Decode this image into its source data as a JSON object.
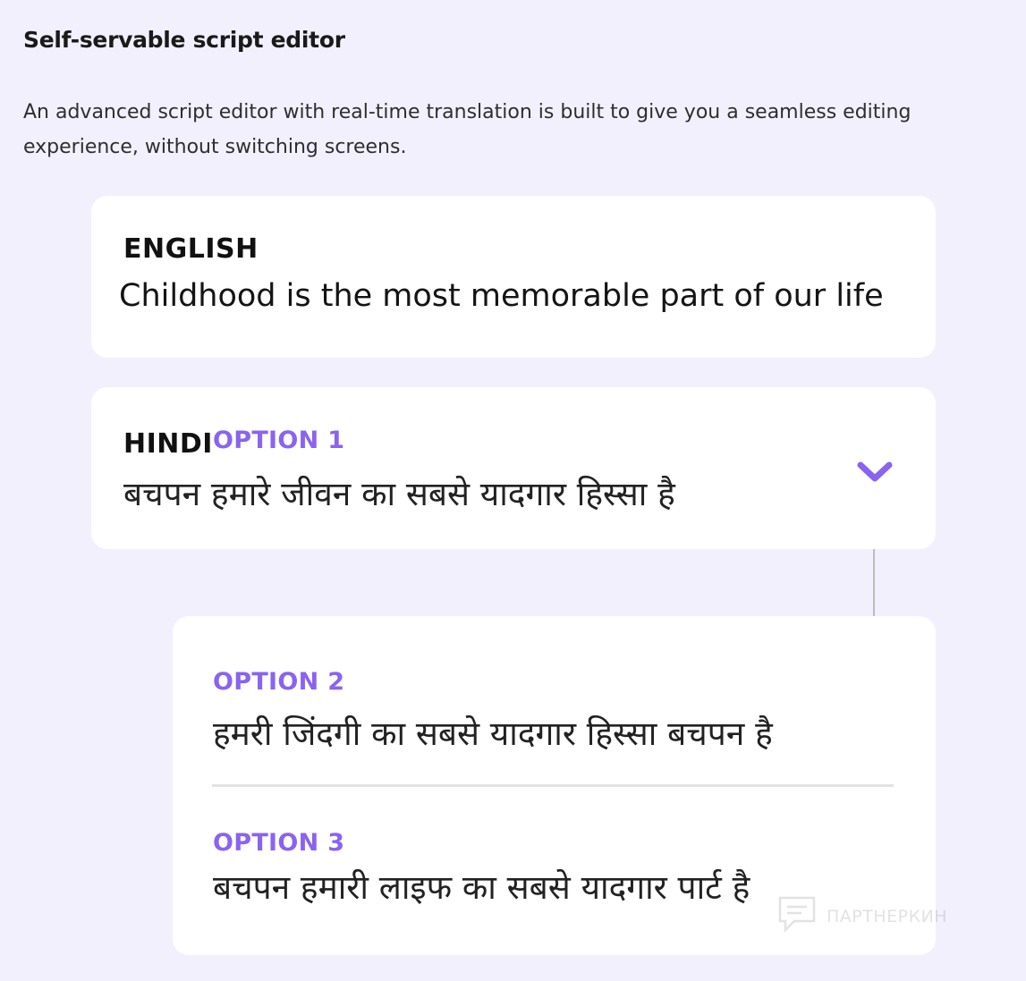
{
  "section": {
    "title": "Self-servable script editor",
    "description": "An advanced script editor with real-time translation is built to give you a seamless editing experience, without switching screens."
  },
  "english_card": {
    "language": "ENGLISH",
    "text": "Childhood is the most memorable part of our life"
  },
  "hindi_card": {
    "language": "HINDI",
    "selected_option": "OPTION 1",
    "text": "बचपन हमारे जीवन का सबसे यादगार हिस्सा है",
    "toggle_icon": "chevron-down-icon"
  },
  "options": [
    {
      "label": "OPTION 2",
      "text": "हमरी जिंदगी का सबसे यादगार हिस्सा बचपन है"
    },
    {
      "label": "OPTION 3",
      "text": "बचपन हमारी लाइफ का सबसे यादगार पार्ट है"
    }
  ],
  "watermark": {
    "text": "ПАРТНЕРКИН",
    "icon": "chat-bubble-icon"
  },
  "colors": {
    "background": "#f2f0fd",
    "accent": "#8a63f0",
    "card": "#ffffff"
  }
}
